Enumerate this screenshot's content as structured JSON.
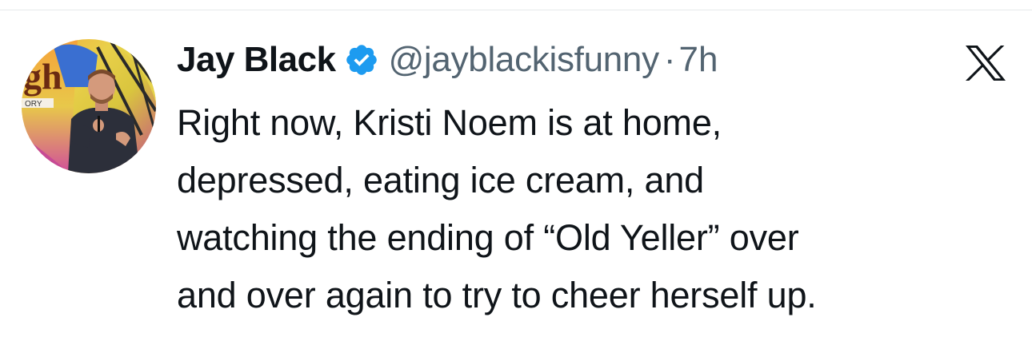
{
  "author": {
    "display_name": "Jay Black",
    "handle": "@jayblackisfunny",
    "separator": "·",
    "timestamp": "7h",
    "verified": true,
    "avatar_icon": "comedian-on-stage-avatar"
  },
  "platform_icon": "x-logo-icon",
  "tweet": {
    "lines": [
      "Right now, Kristi Noem is at home,",
      "depressed, eating ice cream, and",
      "watching the ending of “Old Yeller” over",
      "and over again to try to cheer herself up."
    ]
  },
  "colors": {
    "text_primary": "#0f1419",
    "text_secondary": "#536471",
    "verified_blue": "#1d9bf0",
    "divider": "#e6e9eb"
  }
}
